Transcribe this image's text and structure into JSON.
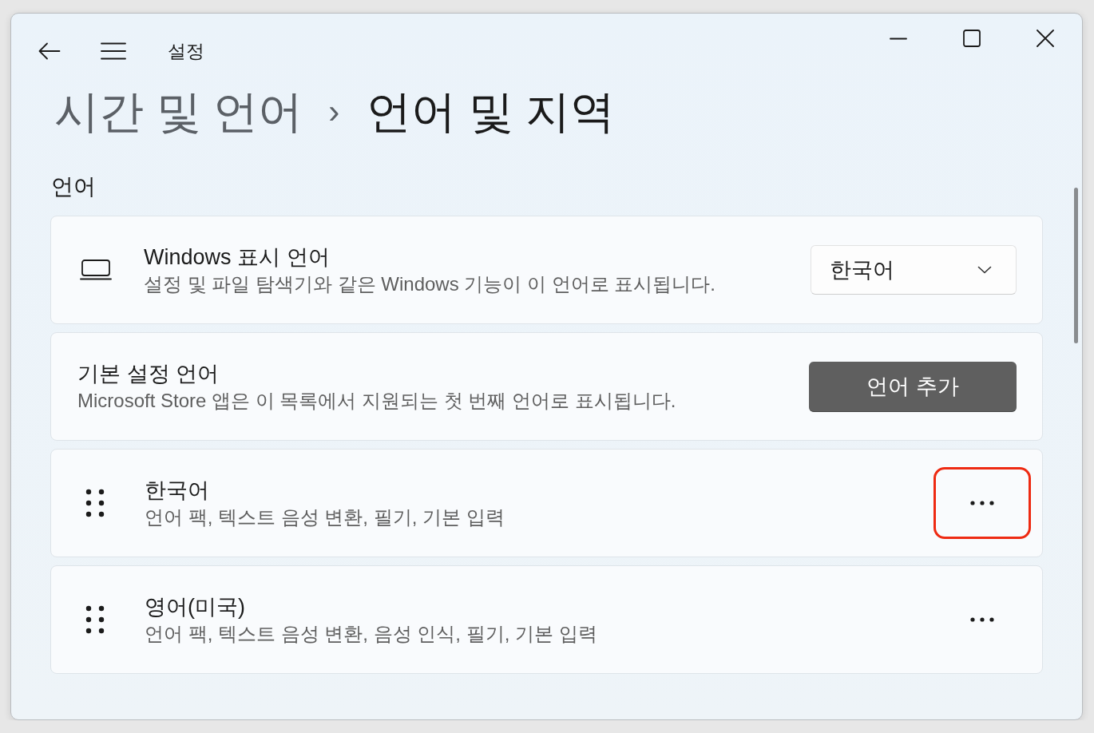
{
  "window": {
    "title": "설정"
  },
  "breadcrumb": {
    "parent": "시간 및 언어",
    "separator": "›",
    "current": "언어 및 지역"
  },
  "section_heading": "언어",
  "display_language": {
    "title": "Windows 표시 언어",
    "description": "설정 및 파일 탐색기와 같은 Windows 기능이 이 언어로 표시됩니다.",
    "dropdown": {
      "value": "한국어"
    }
  },
  "preferred_languages": {
    "title": "기본 설정 언어",
    "description": "Microsoft Store 앱은 이 목록에서 지원되는 첫 번째 언어로 표시됩니다.",
    "button": "언어 추가"
  },
  "languages": [
    {
      "name": "한국어",
      "features": "언어 팩, 텍스트 음성 변환, 필기, 기본 입력",
      "highlighted": true
    },
    {
      "name": "영어(미국)",
      "features": "언어 팩, 텍스트 음성 변환, 음성 인식, 필기, 기본 입력",
      "highlighted": false
    }
  ]
}
